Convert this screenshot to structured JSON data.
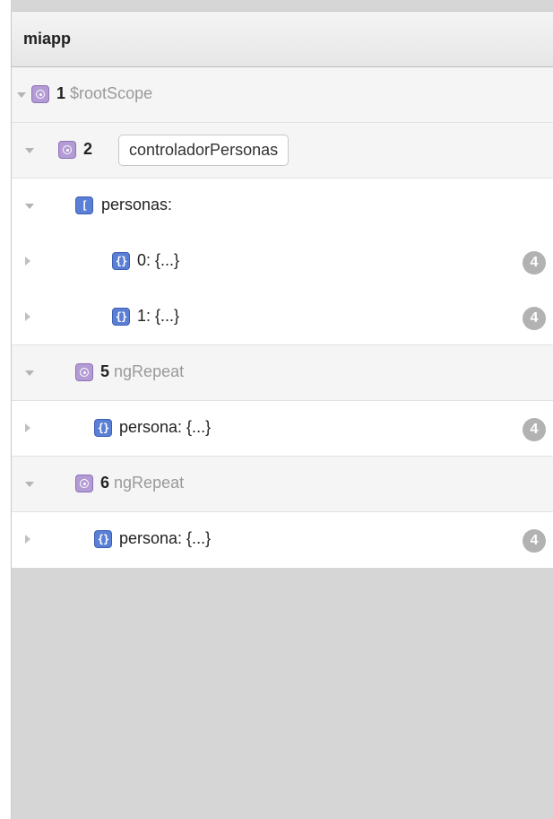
{
  "app": {
    "title": "miapp"
  },
  "tree": {
    "root_scope": {
      "id": "1",
      "name": "$rootScope",
      "icon": "scope-icon"
    },
    "controller_scope": {
      "id": "2",
      "name": "controladorPersonas",
      "icon": "scope-icon"
    },
    "personas": {
      "label": "personas:",
      "icon": "array-icon",
      "items": [
        {
          "label": "0: {...}",
          "count": "4",
          "icon": "object-icon"
        },
        {
          "label": "1: {...}",
          "count": "4",
          "icon": "object-icon"
        }
      ]
    },
    "repeat_scopes": [
      {
        "id": "5",
        "name": "ngRepeat",
        "property": "persona: {...}",
        "count": "4"
      },
      {
        "id": "6",
        "name": "ngRepeat",
        "property": "persona: {...}",
        "count": "4"
      }
    ]
  },
  "colors": {
    "scope_icon": "#b39bd4",
    "object_icon": "#5a7fd6",
    "badge": "#b2b2b2",
    "header_bg": "#ececec",
    "empty_area": "#d6d6d6"
  },
  "icons": {
    "scope": "scope-icon",
    "array": "array-icon",
    "object": "object-icon",
    "badge": "count-badge",
    "toggle_open": "disclosure-down-icon",
    "toggle_closed": "disclosure-right-icon"
  }
}
